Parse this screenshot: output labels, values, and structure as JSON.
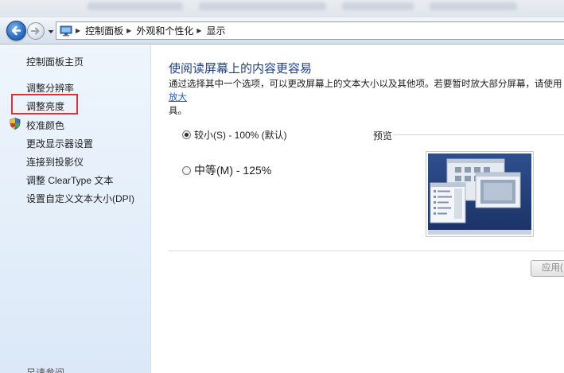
{
  "breadcrumb": [
    "控制面板",
    "外观和个性化",
    "显示"
  ],
  "sidebar": {
    "home": "控制面板主页",
    "items": [
      "调整分辨率",
      "调整亮度",
      "校准颜色",
      "更改显示器设置",
      "连接到投影仪",
      "调整 ClearType 文本",
      "设置自定义文本大小(DPI)"
    ],
    "see_also": "另请参阅"
  },
  "main": {
    "title": "使阅读屏幕上的内容更容易",
    "description_line1": "通过选择其中一个选项，可以更改屏幕上的文本大小以及其他项。若要暂时放大部分屏幕，请使用",
    "description_link": "放大",
    "description_line2": "具。",
    "options": [
      {
        "label": "较小(S) - 100% (默认)",
        "checked": true
      },
      {
        "label": "中等(M) - 125%",
        "checked": false
      }
    ],
    "preview_label": "预览",
    "apply_label": "应用("
  },
  "icons": {
    "back": "back-arrow-icon",
    "forward": "forward-arrow-icon",
    "history": "chevron-down-icon",
    "location": "monitor-icon",
    "calibrate": "shield-icon"
  },
  "colors": {
    "title": "#1e3f86",
    "link": "#1c5fc2",
    "highlight_box": "#e5303a",
    "sidebar_bg": "#e3eefa"
  }
}
